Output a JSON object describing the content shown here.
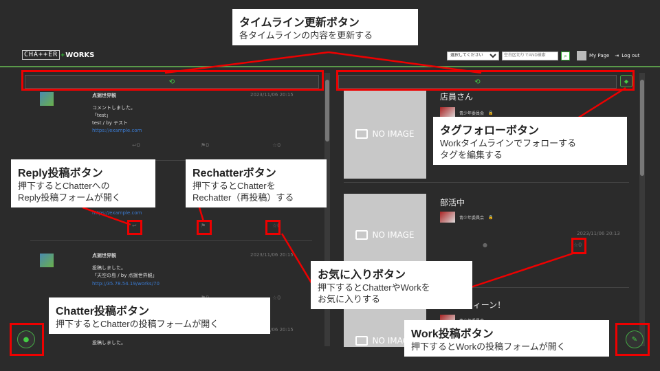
{
  "header": {
    "logo_box": "CHA++ER",
    "logo_plus": "+",
    "logo_works": "WORKS",
    "select_value": "選択してください",
    "search_placeholder": "空白区切りでAND検索",
    "mypage": "My Page",
    "logout": "Log out"
  },
  "left_panel": {
    "refresh_icon": "⟲",
    "posts": [
      {
        "name": "点掘世界観",
        "date": "2023/11/06 20:15",
        "body": "コメントしました。\n「test」\ntest / by テスト",
        "url": "https://example.com",
        "reply": "0",
        "rechatter": "0",
        "fav": "0"
      },
      {
        "name": "",
        "date": "",
        "body": "",
        "url": "https://example.com",
        "reply": "",
        "rechatter": "",
        "fav": "0"
      },
      {
        "name": "点掘世界観",
        "date": "2023/11/06 20:15",
        "body": "投稿しました。\n「天空の島 / by 点掘世界観」",
        "url": "http://35.78.54.19/works/70",
        "reply": "",
        "rechatter": "0",
        "fav": "0"
      },
      {
        "name": "",
        "date": "2023/11/06 20:15",
        "body": "投稿しました。",
        "url": "",
        "reply": "",
        "rechatter": "",
        "fav": ""
      }
    ]
  },
  "right_panel": {
    "works": [
      {
        "title": "店員さん",
        "group": "青少年委員会",
        "date": "",
        "fav": ""
      },
      {
        "title": "部活中",
        "group": "青少年委員会",
        "date": "2023/11/06 20:13",
        "fav": "0"
      },
      {
        "title": "ーハロウィーン！",
        "group": "青少年委員会",
        "date": "",
        "fav": ""
      }
    ],
    "no_image": "NO IMAGE"
  },
  "annotations": {
    "refresh": {
      "title": "タイムライン更新ボタン",
      "desc": "各タイムラインの内容を更新する"
    },
    "tag": {
      "title": "タグフォローボタン",
      "desc": "Workタイムラインでフォローする\nタグを編集する"
    },
    "reply": {
      "title": "Reply投稿ボタン",
      "desc": "押下するとChatterへの\nReply投稿フォームが開く"
    },
    "rechatter": {
      "title": "Rechatterボタン",
      "desc": "押下するとChatterを\nRechatter（再投稿）する"
    },
    "fav": {
      "title": "お気に入りボタン",
      "desc": "押下するとChatterやWorkを\nお気に入りする"
    },
    "chatter": {
      "title": "Chatter投稿ボタン",
      "desc": "押下するとChatterの投稿フォームが開く"
    },
    "work": {
      "title": "Work投稿ボタン",
      "desc": "押下するとWorkの投稿フォームが開く"
    }
  },
  "colors": {
    "accent": "#44cc44",
    "annotation_red": "#e00000",
    "link": "#3a7ad0"
  }
}
